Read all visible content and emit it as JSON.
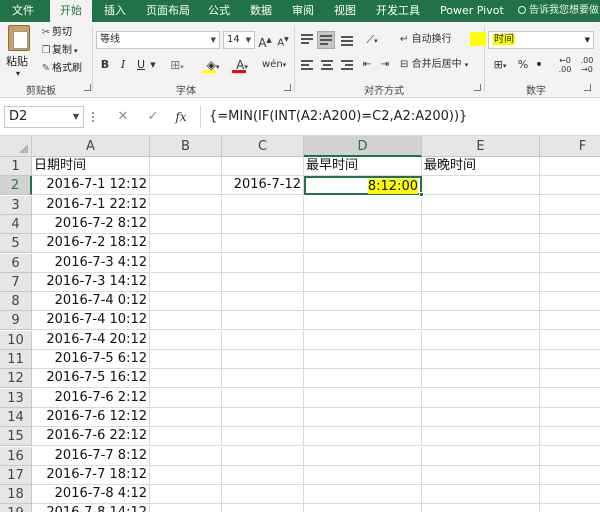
{
  "ribbon_tabs": [
    "文件",
    "开始",
    "插入",
    "页面布局",
    "公式",
    "数据",
    "审阅",
    "视图",
    "开发工具",
    "Power Pivot"
  ],
  "active_tab": "开始",
  "tell_me": "告诉我您想要做",
  "clipboard": {
    "paste": "粘贴",
    "cut": "剪切",
    "copy": "复制",
    "format_painter": "格式刷",
    "group_label": "剪贴板"
  },
  "font": {
    "name": "等线",
    "size": "14",
    "grow": "A",
    "shrink": "A",
    "bold": "B",
    "italic": "I",
    "underline": "U",
    "group_label": "字体",
    "fill_color": "#ffff00",
    "font_color": "#ff0000"
  },
  "alignment": {
    "wrap": "自动换行",
    "merge": "合并后居中",
    "group_label": "对齐方式"
  },
  "number": {
    "format": "时间",
    "percent": "%",
    "comma": "•",
    "group_label": "数字"
  },
  "name_box": "D2",
  "formula": "{=MIN(IF(INT(A2:A200)=C2,A2:A200))}",
  "columns": [
    "A",
    "B",
    "C",
    "D",
    "E",
    "F"
  ],
  "selected_column": "D",
  "selected_row": "2",
  "headers_row1": {
    "A": "日期时间",
    "D": "最早时间",
    "E": "最晚时间"
  },
  "c2": "2016-7-12",
  "d2": "8:12:00",
  "rows": [
    {
      "n": "1",
      "a": ""
    },
    {
      "n": "2",
      "a": "2016-7-1 12:12"
    },
    {
      "n": "3",
      "a": "2016-7-1 22:12"
    },
    {
      "n": "4",
      "a": "2016-7-2 8:12"
    },
    {
      "n": "5",
      "a": "2016-7-2 18:12"
    },
    {
      "n": "6",
      "a": "2016-7-3 4:12"
    },
    {
      "n": "7",
      "a": "2016-7-3 14:12"
    },
    {
      "n": "8",
      "a": "2016-7-4 0:12"
    },
    {
      "n": "9",
      "a": "2016-7-4 10:12"
    },
    {
      "n": "10",
      "a": "2016-7-4 20:12"
    },
    {
      "n": "11",
      "a": "2016-7-5 6:12"
    },
    {
      "n": "12",
      "a": "2016-7-5 16:12"
    },
    {
      "n": "13",
      "a": "2016-7-6 2:12"
    },
    {
      "n": "14",
      "a": "2016-7-6 12:12"
    },
    {
      "n": "15",
      "a": "2016-7-6 22:12"
    },
    {
      "n": "16",
      "a": "2016-7-7 8:12"
    },
    {
      "n": "17",
      "a": "2016-7-7 18:12"
    },
    {
      "n": "18",
      "a": "2016-7-8 4:12"
    },
    {
      "n": "19",
      "a": "2016-7-8 14:12"
    }
  ],
  "colors": {
    "accent": "#217346",
    "highlight": "#ffff00"
  }
}
